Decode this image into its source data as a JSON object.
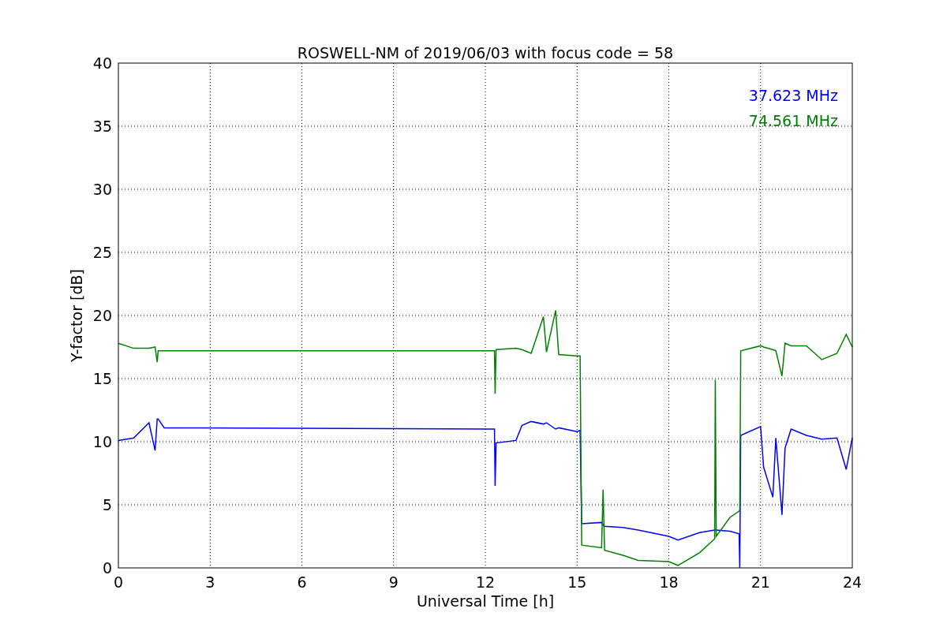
{
  "chart": {
    "chart_data": {
      "type": "line",
      "grid": true,
      "title": "ROSWELL-NM of 2019/06/03 with focus code = 58",
      "xlabel": "Universal Time [h]",
      "ylabel": "Y-factor [dB]",
      "x": [
        0,
        0.5,
        1.0,
        1.2,
        1.27,
        1.3,
        1.5,
        12.3,
        12.32,
        12.35,
        13,
        13.2,
        13.5,
        13.9,
        14.0,
        14.3,
        14.4,
        15,
        15.1,
        15.15,
        15.8,
        15.85,
        15.9,
        16.5,
        17,
        18,
        18.3,
        19,
        19.5,
        19.52,
        19.55,
        20,
        20.3,
        20.32,
        20.35,
        21,
        21.1,
        21.4,
        21.5,
        21.7,
        21.8,
        22,
        22.5,
        23,
        23.5,
        23.8,
        24
      ],
      "series": [
        {
          "name": "37.623 MHz",
          "color": "#0000ff",
          "values": [
            10.1,
            10.3,
            11.5,
            9.3,
            11.8,
            11.8,
            11.1,
            11.0,
            6.5,
            9.9,
            10.1,
            11.3,
            11.6,
            11.4,
            11.5,
            11.0,
            11.1,
            10.8,
            10.9,
            3.5,
            3.6,
            3.4,
            3.3,
            3.2,
            3.0,
            2.5,
            2.2,
            2.8,
            3.0,
            3.0,
            3.0,
            2.9,
            2.7,
            0,
            10.5,
            11.2,
            8.0,
            5.6,
            10.3,
            4.2,
            9.5,
            11.0,
            10.5,
            10.2,
            10.3,
            7.8,
            10.3
          ]
        },
        {
          "name": "74.561 MHz",
          "color": "#008000",
          "values": [
            17.8,
            17.4,
            17.4,
            17.5,
            16.3,
            17.2,
            17.2,
            17.2,
            13.8,
            17.3,
            17.4,
            17.3,
            17.0,
            19.9,
            17.1,
            20.4,
            16.9,
            16.8,
            16.8,
            1.8,
            1.6,
            6.2,
            1.4,
            1.0,
            0.6,
            0.5,
            0.2,
            1.2,
            2.3,
            14.9,
            2.5,
            4.0,
            4.5,
            4.6,
            17.2,
            17.6,
            17.5,
            17.3,
            17.2,
            15.2,
            17.8,
            17.6,
            17.6,
            16.5,
            17.0,
            18.5,
            17.5
          ]
        }
      ],
      "xlim": [
        0,
        24
      ],
      "ylim": [
        0,
        40
      ],
      "xticks": [
        0,
        3,
        6,
        9,
        12,
        15,
        18,
        21,
        24
      ],
      "yticks": [
        0,
        5,
        10,
        15,
        20,
        25,
        30,
        35,
        40
      ]
    }
  }
}
